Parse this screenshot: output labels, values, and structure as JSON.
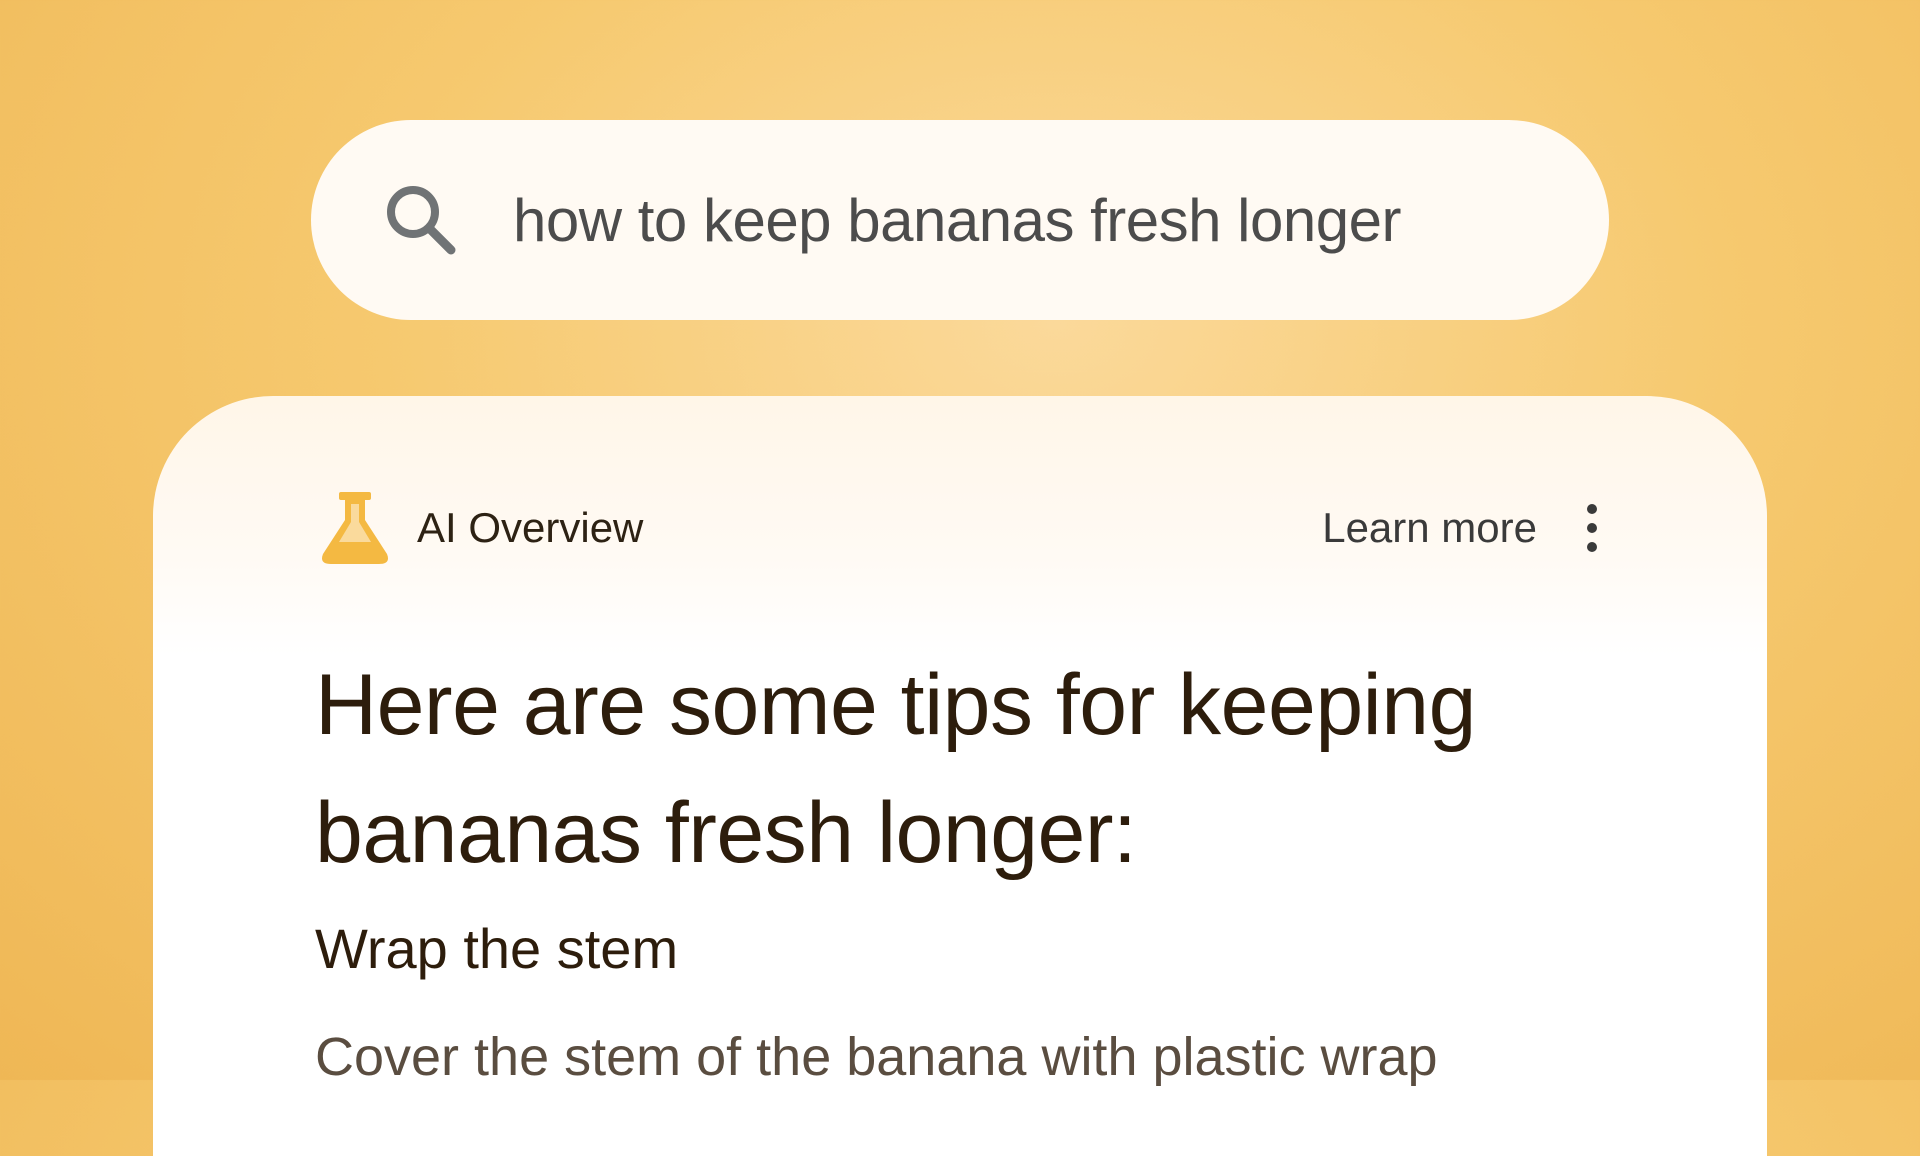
{
  "search": {
    "query": "how to keep bananas fresh longer",
    "icon": "search-icon"
  },
  "overview": {
    "icon": "flask-icon",
    "title": "AI Overview",
    "learn_more_label": "Learn more",
    "more_icon": "more-vert-icon",
    "headline": "Here are some tips for keeping bananas fresh longer:",
    "tips": [
      {
        "title": "Wrap the stem",
        "body": "Cover the stem of the banana with plastic wrap"
      }
    ]
  },
  "colors": {
    "background": "#f6c96f",
    "accent": "#f4b942",
    "text_dark": "#2d1d0c"
  }
}
